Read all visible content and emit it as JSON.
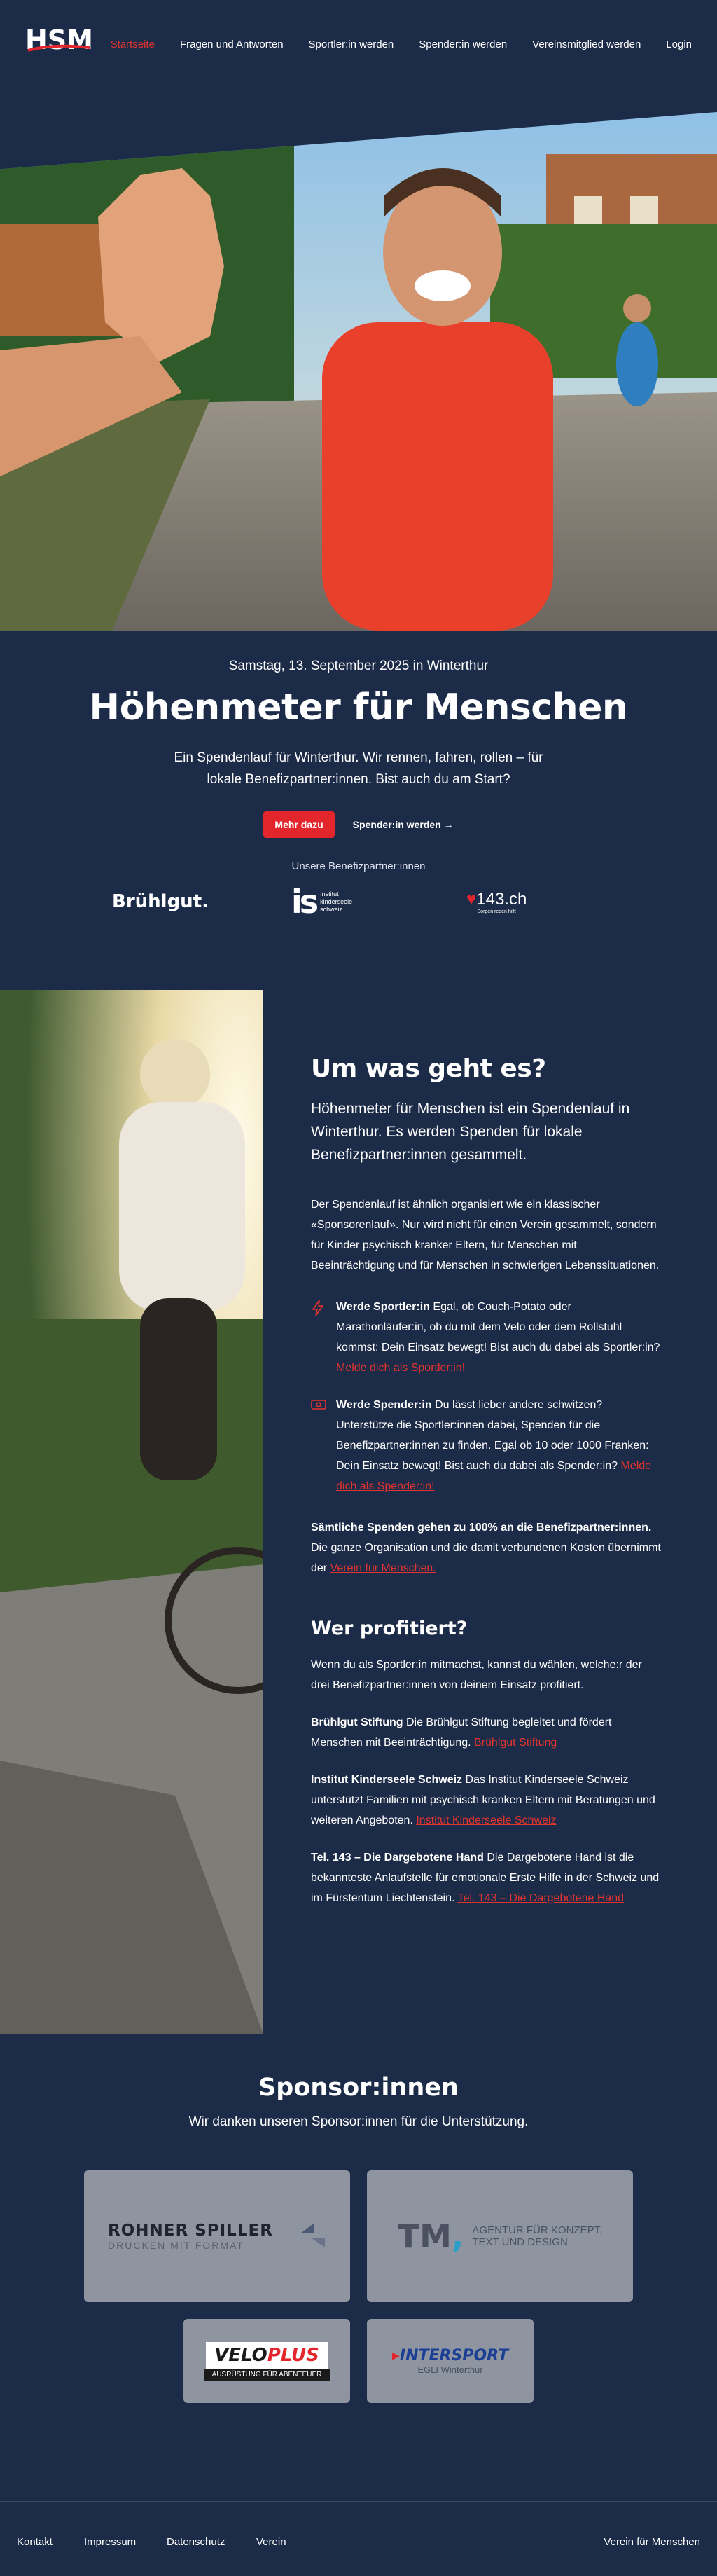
{
  "nav": {
    "logo_text": "HSM",
    "links": [
      "Startseite",
      "Fragen und Antworten",
      "Sportler:in werden",
      "Spender:in werden",
      "Vereinsmitglied werden",
      "Login"
    ]
  },
  "hero": {
    "date": "Samstag, 13. September 2025 in Winterthur",
    "title": "Höhenmeter für Menschen",
    "description": "Ein Spendenlauf für Winterthur. Wir rennen, fahren, rollen – für lokale Benefizpartner:innen. Bist auch du am Start?",
    "cta_primary": "Mehr dazu",
    "cta_secondary": "Spender:in werden →",
    "partners_label": "Unsere Benefizpartner:innen",
    "partner_logos": {
      "bruehlgut": "Brühlgut.",
      "is_small": "Institut kinderseele schweiz",
      "tel": "143.ch",
      "tel_small": "Sorgen reden hilft"
    }
  },
  "about": {
    "title": "Um was geht es?",
    "lead": "Höhenmeter für Menschen ist ein Spendenlauf in Winterthur. Es werden Spenden für lokale Benefizpartner:innen gesammelt.",
    "body": "Der Spendenlauf ist ähnlich organisiert wie ein klassischer «Sponsorenlauf». Nur wird nicht für einen Verein gesammelt, sondern für Kinder psychisch kranker Eltern, für Menschen mit Beeinträchtigung und für Menschen in schwierigen Lebenssituationen.",
    "role_sportler_title": "Werde Sportler:in",
    "role_sportler_text": "Egal, ob Couch-Potato oder Marathonläufer:in, ob du mit dem Velo oder dem Rollstuhl kommst: Dein Einsatz bewegt! Bist auch du dabei als Sportler:in?",
    "role_sportler_link": "Melde dich als Sportler:in!",
    "role_spender_title": "Werde Spender:in",
    "role_spender_text": "Du lässt lieber andere schwitzen? Unterstütze die Sportler:innen dabei, Spenden für die Benefizpartner:innen zu finden. Egal ob 10 oder 1000 Franken: Dein Einsatz bewegt! Bist auch du dabei als Spender:in?",
    "role_spender_link": "Melde dich als Spender:in!",
    "donation_strong": "Sämtliche Spenden gehen zu 100% an die Benefizpartner:innen.",
    "donation_text": "Die ganze Organisation und die damit verbundenen Kosten übernimmt der",
    "donation_link": "Verein für Menschen.",
    "profit_title": "Wer profitiert?",
    "profit_intro": "Wenn du als Sportler:in mitmachst, kannst du wählen, welche:r der drei Benefizpartner:innen von deinem Einsatz profitiert.",
    "partners": [
      {
        "name": "Brühlgut Stiftung",
        "text": "Die Brühlgut Stiftung begleitet und fördert Menschen mit Beeinträchtigung.",
        "link": "Brühlgut Stiftung"
      },
      {
        "name": "Institut Kinderseele Schweiz",
        "text": "Das Institut Kinderseele Schweiz unterstützt Familien mit psychisch kranken Eltern mit Beratungen und weiteren Angeboten.",
        "link": "Institut Kinderseele Schweiz"
      },
      {
        "name": "Tel. 143 – Die Dargebotene Hand",
        "text": "Die Dargebotene Hand ist die bekannteste Anlaufstelle für emotionale Erste Hilfe in der Schweiz und im Fürstentum Liechtenstein.",
        "link": "Tel. 143 – Die Dargebotene Hand"
      }
    ]
  },
  "sponsors": {
    "title": "Sponsor:innen",
    "subtitle": "Wir danken unseren Sponsor:innen für die Unterstützung.",
    "rohner_main": "ROHNER SPILLER",
    "rohner_sub": "DRUCKEN MIT FORMAT",
    "tm_main": "TM",
    "tm_sub1": "AGENTUR FÜR KONZEPT,",
    "tm_sub2": "TEXT UND DESIGN",
    "velo_main1": "VELO",
    "velo_main2": "PLUS",
    "velo_sub": "AUSRÜSTUNG FÜR ABENTEUER",
    "intersport_main": "INTERSPORT",
    "intersport_sub": "EGLI Winterthur"
  },
  "footer": {
    "links": [
      "Kontakt",
      "Impressum",
      "Datenschutz",
      "Verein"
    ],
    "right": "Verein für Menschen"
  },
  "colors": {
    "background": "#1c2b47",
    "accent": "#e3262b",
    "card": "#8e95a1"
  }
}
